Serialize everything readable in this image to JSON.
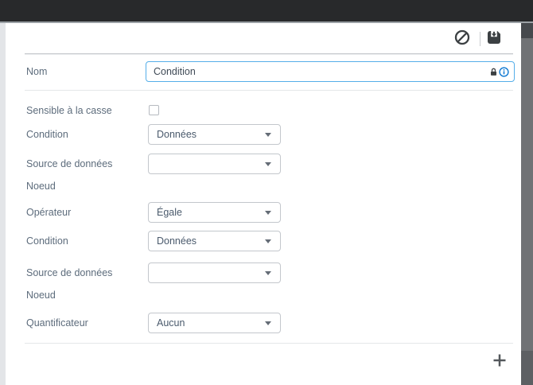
{
  "toolbar": {
    "cancel_icon": "block-icon",
    "save_icon": "save-icon"
  },
  "form": {
    "name_row": {
      "label": "Nom",
      "value": "Condition",
      "icons": [
        "lock-icon",
        "info-icon"
      ]
    },
    "rows": [
      {
        "label": "Sensible à la casse",
        "type": "checkbox",
        "checked": false
      },
      {
        "label": "Condition",
        "type": "dropdown",
        "value": "Données"
      },
      {
        "label": "Source de données",
        "type": "dropdown",
        "value": ""
      },
      {
        "label": "Noeud",
        "type": "label"
      },
      {
        "label": "Opérateur",
        "type": "dropdown",
        "value": "Égale"
      },
      {
        "label": "Condition",
        "type": "dropdown",
        "value": "Données"
      },
      {
        "label": "Source de données",
        "type": "dropdown",
        "value": ""
      },
      {
        "label": "Noeud",
        "type": "label"
      },
      {
        "label": "Quantificateur",
        "type": "dropdown",
        "value": "Aucun"
      }
    ]
  },
  "footer": {
    "add_icon": "plus-icon"
  },
  "colors": {
    "topbar": "#28292b",
    "input_focus_border": "#55aee9",
    "info_icon_blue": "#1a7fd4",
    "label_text": "#5d6c7c",
    "control_text": "#4a5a6c",
    "icon_dark": "#3c4043"
  }
}
